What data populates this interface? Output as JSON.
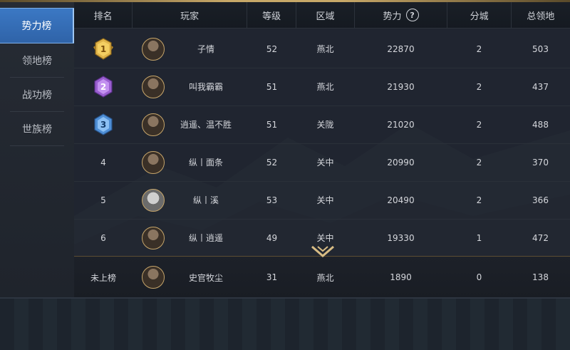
{
  "sidebar": {
    "items": [
      {
        "label": "势力榜",
        "active": true
      },
      {
        "label": "领地榜",
        "active": false
      },
      {
        "label": "战功榜",
        "active": false
      },
      {
        "label": "世族榜",
        "active": false
      }
    ]
  },
  "table": {
    "headers": {
      "rank": "排名",
      "player": "玩家",
      "level": "等级",
      "region": "区域",
      "power": "势力",
      "city": "分城",
      "land": "总领地"
    },
    "rows": [
      {
        "rank": "1",
        "medal": "gold-medal-icon",
        "name": "子情",
        "level": "52",
        "region": "燕北",
        "power": "22870",
        "city": "2",
        "land": "503"
      },
      {
        "rank": "2",
        "medal": "purple-medal-icon",
        "name": "叫我霸霸",
        "level": "51",
        "region": "燕北",
        "power": "21930",
        "city": "2",
        "land": "437"
      },
      {
        "rank": "3",
        "medal": "blue-medal-icon",
        "name": "逍遥、温不胜",
        "level": "51",
        "region": "关陇",
        "power": "21020",
        "city": "2",
        "land": "488"
      },
      {
        "rank": "4",
        "name": "纵丨面条",
        "level": "52",
        "region": "关中",
        "power": "20990",
        "city": "2",
        "land": "370"
      },
      {
        "rank": "5",
        "name": "纵丨溪",
        "level": "53",
        "region": "关中",
        "power": "20490",
        "city": "2",
        "land": "366"
      },
      {
        "rank": "6",
        "name": "纵丨逍遥",
        "level": "49",
        "region": "关中",
        "power": "19330",
        "city": "1",
        "land": "472"
      }
    ],
    "self": {
      "rank": "未上榜",
      "name": "史官牧尘",
      "level": "31",
      "region": "燕北",
      "power": "1890",
      "city": "0",
      "land": "138"
    }
  },
  "colors": {
    "accent": "#3b78c4",
    "gold": "#c8a868",
    "text": "#d5d7dc"
  }
}
